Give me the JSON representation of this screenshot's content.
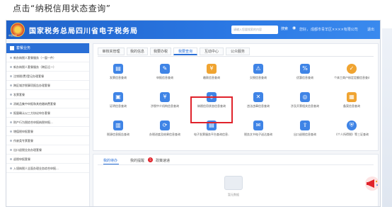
{
  "instruction": "点击“纳税信用状态查询”",
  "header": {
    "title": "国家税务总局四川省电子税务局",
    "emblem_text": "中国税务",
    "search_placeholder": "请输入您要搜索的内容",
    "search_button": "搜索",
    "items": [
      "您好，",
      "成都市青羊区××××有限公司",
      "退出"
    ]
  },
  "sidebar": {
    "title": "套餐业务",
    "items": [
      "新办纳税人套餐服务（一窗一件）",
      "新办纳税人套餐服务（跨区迁一）",
      "注销税(费)登记办理套餐",
      "跨区域涉税事项报告办理套餐",
      "发票套餐",
      "消耗品集中申报和其他缴纳费套餐",
      "报量确认以三方协议申办套餐",
      "财产行为税综合申报纳税申报...",
      "增值税申报套餐",
      "作废类专票套餐",
      "出口退税业务办理套餐",
      "退税申报套餐",
      "入境纳税人全面办理业务综合申报..."
    ]
  },
  "main": {
    "tabs": [
      {
        "label": "审核夹管理",
        "active": false
      },
      {
        "label": "我的信息",
        "active": false
      },
      {
        "label": "我要办税",
        "active": false
      },
      {
        "label": "我要查询",
        "active": true
      },
      {
        "label": "互动中心",
        "active": false
      },
      {
        "label": "公众服务",
        "active": false
      }
    ],
    "tiles": [
      {
        "label": "发票信息查询",
        "icon": "invoice-icon",
        "color": "#3f84e6"
      },
      {
        "label": "申报信息查询",
        "icon": "declaration-icon",
        "color": "#3f84e6"
      },
      {
        "label": "缴款信息查询",
        "icon": "payment-icon",
        "color": "#f0a431"
      },
      {
        "label": "欠税信息查询",
        "icon": "arrears-icon",
        "color": "#3f84e6"
      },
      {
        "label": "优惠信息查询",
        "icon": "discount-icon",
        "color": "#3f84e6"
      },
      {
        "label": "个体工商户核定定额信息查询",
        "icon": "check-icon",
        "color": "#f0a431"
      },
      {
        "label": "证明信息查询",
        "icon": "certificate-icon",
        "color": "#3f84e6"
      },
      {
        "label": "涉税中介机构信息查询",
        "icon": "agency-icon",
        "color": "#3f84e6"
      },
      {
        "label": "纳税信用状态信息查询",
        "icon": "credit-status-icon",
        "color": "#3f84e6"
      },
      {
        "label": "违法违章信息查询",
        "icon": "violation-icon",
        "color": "#3f84e6"
      },
      {
        "label": "涉及开票相关信息查询",
        "icon": "fingerprint-icon",
        "color": "#3f84e6"
      },
      {
        "label": "备案信息查询",
        "icon": "filing-icon",
        "color": "#f0a431"
      },
      {
        "label": "税源信息报告查询",
        "icon": "tax-source-icon",
        "color": "#3f84e6"
      },
      {
        "label": "办税进度及结果信息查询",
        "icon": "progress-icon",
        "color": "#3f84e6"
      },
      {
        "label": "电子发票服务平台查询信息...",
        "icon": "e-invoice-icon",
        "color": "#3f84e6"
      },
      {
        "label": "税务文书电子送达查询",
        "icon": "document-icon",
        "color": "#3f84e6"
      },
      {
        "label": "出口退税信息查询",
        "icon": "export-icon",
        "color": "#3f84e6"
      },
      {
        "label": "《个人所得税》等三证查询",
        "icon": "shield-icon",
        "color": "#3f84e6"
      }
    ]
  },
  "panel": {
    "tabs": [
      {
        "label": "我的待办",
        "active": true
      },
      {
        "label": "我的提醒",
        "active": false
      },
      {
        "label": "政策速递",
        "active": false
      }
    ],
    "badge": "5",
    "empty_text": "暂无数据"
  },
  "colors": {
    "brand_blue": "#2a6fd6",
    "highlight_red": "#e0232b",
    "accent_orange": "#f0a431"
  }
}
